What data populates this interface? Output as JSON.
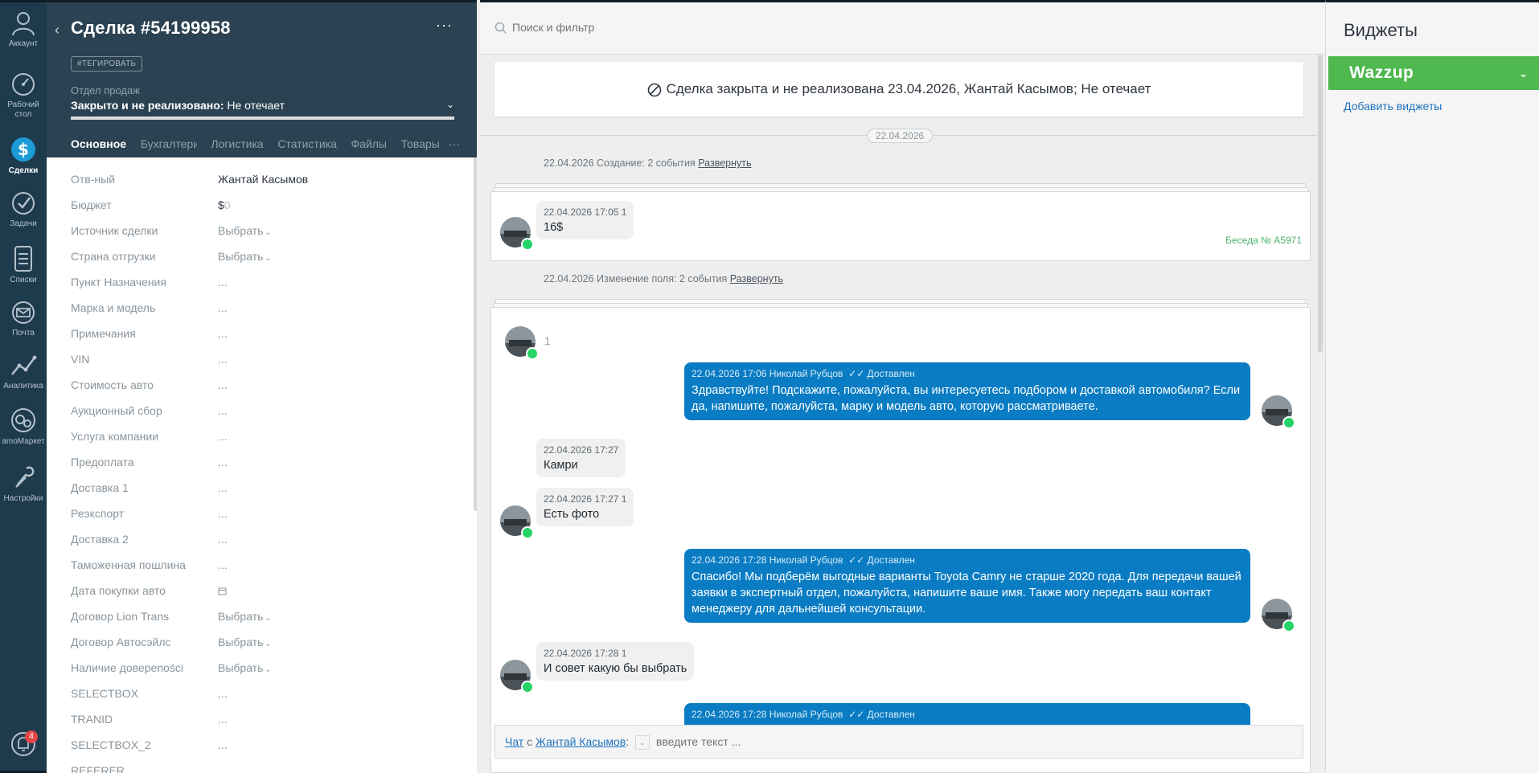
{
  "nav": {
    "items": [
      {
        "label": "Аккаунт",
        "icon": "account-icon"
      },
      {
        "label": "Рабочий стол",
        "icon": "dashboard-icon"
      },
      {
        "label": "Сделки",
        "icon": "deals-icon"
      },
      {
        "label": "Задачи",
        "icon": "tasks-icon"
      },
      {
        "label": "Списки",
        "icon": "lists-icon"
      },
      {
        "label": "Почта",
        "icon": "mail-icon"
      },
      {
        "label": "Аналитика",
        "icon": "analytics-icon"
      },
      {
        "label": "amoМаркет",
        "icon": "market-icon"
      },
      {
        "label": "Настройки",
        "icon": "settings-icon"
      }
    ],
    "notifications_count": "4"
  },
  "card": {
    "title": "Сделка #54199958",
    "tag_button": "#ТЕГИРОВАТЬ",
    "pipeline": "Отдел продаж",
    "status_bold": "Закрыто и не реализовано:",
    "status_reason": "Не отечает",
    "tabs": [
      "Основное",
      "Бухгалтерия",
      "Логистика",
      "Статистика",
      "Файлы",
      "Товары"
    ],
    "tabs_more": "···",
    "fields": [
      {
        "label": "Отв-ный",
        "value": "Жантай Касымов",
        "kind": "text"
      },
      {
        "label": "Бюджет",
        "value": "$",
        "extra": "0",
        "kind": "budget"
      },
      {
        "label": "Источник сделки",
        "value": "Выбрать",
        "kind": "select"
      },
      {
        "label": "Страна отгрузки",
        "value": "Выбрать",
        "kind": "select"
      },
      {
        "label": "Пункт Назначения",
        "value": "...",
        "kind": "empty"
      },
      {
        "label": "Марка и модель",
        "value": "...",
        "kind": "empty"
      },
      {
        "label": "Примечания",
        "value": "...",
        "kind": "empty"
      },
      {
        "label": "VIN",
        "value": "...",
        "kind": "empty"
      },
      {
        "label": "Стоимость авто",
        "value": "...",
        "kind": "empty"
      },
      {
        "label": "Аукционный сбор",
        "value": "...",
        "kind": "empty"
      },
      {
        "label": "Услуга компании",
        "value": "...",
        "kind": "empty"
      },
      {
        "label": "Предоплата",
        "value": "...",
        "kind": "empty"
      },
      {
        "label": "Доставка 1",
        "value": "...",
        "kind": "empty"
      },
      {
        "label": "Реэкспорт",
        "value": "...",
        "kind": "empty"
      },
      {
        "label": "Доставка 2",
        "value": "...",
        "kind": "empty"
      },
      {
        "label": "Таможенная пошлина",
        "value": "...",
        "kind": "empty"
      },
      {
        "label": "Дата покупки авто",
        "value": "",
        "kind": "date"
      },
      {
        "label": "Договор Lion Trans",
        "value": "Выбрать",
        "kind": "select"
      },
      {
        "label": "Договор Автосэйлс",
        "value": "Выбрать",
        "kind": "select"
      },
      {
        "label": "Наличие довереności",
        "value": "Выбрать",
        "kind": "select"
      },
      {
        "label": "SELECTBOX",
        "value": "...",
        "kind": "empty"
      },
      {
        "label": "TRANID",
        "value": "...",
        "kind": "empty"
      },
      {
        "label": "SELECTBOX_2",
        "value": "...",
        "kind": "empty"
      },
      {
        "label": "REFERER",
        "value": "",
        "kind": "empty"
      }
    ]
  },
  "feed": {
    "search_placeholder": "Поиск и фильтр",
    "closed_banner": "Сделка закрыта и не реализована 23.04.2026, Жантай Касымов; Не отечает",
    "date_pill": "22.04.2026",
    "group1": {
      "text": "22.04.2026 Создание: 2 события",
      "expand": "Развернуть"
    },
    "msg1": {
      "meta": "22.04.2026 17:05 1",
      "text": "16$",
      "talk": "Беседа № A5971"
    },
    "group2": {
      "text": "22.04.2026 Изменение поля: 2 события",
      "expand": "Развернуть"
    },
    "chat_header_count": "1",
    "messages": [
      {
        "dir": "out",
        "meta": "22.04.2026 17:06 Николай Рубцов",
        "status": "✓✓ Доставлен",
        "text": "Здравствуйте! Подскажите, пожалуйста, вы интересуетесь подбором и доставкой автомобиля? Если да, напишите, пожалуйста, марку и модель авто, которую рассматриваете."
      },
      {
        "dir": "in",
        "meta": "22.04.2026 17:27",
        "text": "Камри"
      },
      {
        "dir": "in",
        "meta": "22.04.2026 17:27 1",
        "text": "Есть фото"
      },
      {
        "dir": "out",
        "meta": "22.04.2026 17:28 Николай Рубцов",
        "status": "✓✓ Доставлен",
        "text": "Спасибо! Мы подберём выгодные варианты Toyota Camry не старше 2020 года. Для передачи вашей заявки в экспертный отдел, пожалуйста, напишите ваше имя. Также могу передать ваш контакт менеджеру для дальнейшей консультации."
      },
      {
        "dir": "in",
        "meta": "22.04.2026 17:28 1",
        "text": "И совет какую бы выбрать"
      },
      {
        "dir": "out",
        "meta": "22.04.2026 17:28 Николай Рубцов",
        "status": "✓✓ Доставлен",
        "text": ""
      }
    ],
    "compose": {
      "chat": "Чат",
      "with": "с",
      "contact": "Жантай Касымов",
      "placeholder": "введите текст ..."
    }
  },
  "widgets": {
    "title": "Виджеты",
    "wazzup": "Wazzup",
    "add": "Добавить виджеты"
  }
}
